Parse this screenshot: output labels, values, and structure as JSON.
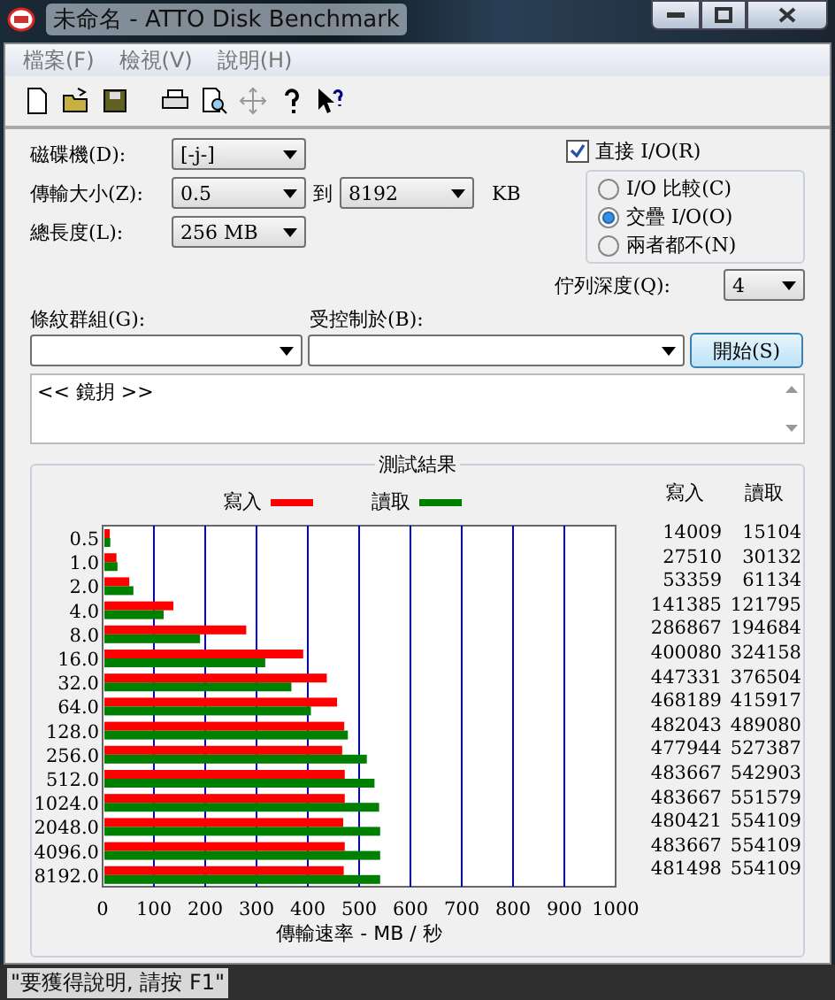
{
  "window": {
    "title": "未命名 - ATTO Disk Benchmark"
  },
  "menu": [
    {
      "label": "檔案(F)"
    },
    {
      "label": "檢視(V)"
    },
    {
      "label": "說明(H)"
    }
  ],
  "toolbar": [
    {
      "kind": "new",
      "disabled": false
    },
    {
      "kind": "open",
      "disabled": false
    },
    {
      "kind": "save",
      "disabled": false
    },
    {
      "kind": "gap"
    },
    {
      "kind": "print",
      "disabled": false
    },
    {
      "kind": "preview",
      "disabled": false
    },
    {
      "kind": "move",
      "disabled": true
    },
    {
      "kind": "help",
      "disabled": false
    },
    {
      "kind": "context-help",
      "disabled": false
    }
  ],
  "settings": {
    "drive": {
      "label": "磁碟機(D):",
      "value": "[-j-]"
    },
    "transfer_size": {
      "label": "傳輸大小(Z):",
      "from": "0.5",
      "joiner": "到",
      "to": "8192",
      "unit": "KB"
    },
    "total_length": {
      "label": "總長度(L):",
      "value": "256 MB"
    },
    "direct_io": {
      "label": "直接 I/O(R)",
      "checked": true
    },
    "io_modes": [
      {
        "label": "I/O 比較(C)",
        "selected": false
      },
      {
        "label": "交疊 I/O(O)",
        "selected": true
      },
      {
        "label": "兩者都不(N)",
        "selected": false
      }
    ],
    "queue_depth": {
      "label": "佇列深度(Q):",
      "value": "4"
    },
    "stripe_group": {
      "label": "條紋群組(G):"
    },
    "controlled_by": {
      "label": "受控制於(B):"
    },
    "start_button": "開始(S)",
    "log": "<< 鏡抈 >>"
  },
  "results": {
    "title": "測試結果",
    "chart_data": {
      "type": "bar",
      "orientation": "horizontal",
      "grid": true,
      "legend": true,
      "xlabel": "傳輸速率 - MB / 秒",
      "categories": [
        "0.5",
        "1.0",
        "2.0",
        "4.0",
        "8.0",
        "16.0",
        "32.0",
        "64.0",
        "128.0",
        "256.0",
        "512.0",
        "1024.0",
        "2048.0",
        "4096.0",
        "8192.0"
      ],
      "xlim": [
        0,
        1000
      ],
      "xticks": [
        0,
        100,
        200,
        300,
        400,
        500,
        600,
        700,
        800,
        900,
        1000
      ],
      "series": [
        {
          "name": "寫入",
          "color": "#ff0000",
          "values": [
            14,
            27,
            52,
            138,
            280,
            391,
            437,
            457,
            471,
            467,
            472,
            472,
            469,
            472,
            470
          ]
        },
        {
          "name": "讀取",
          "color": "#008000",
          "values": [
            15,
            29,
            60,
            119,
            190,
            317,
            368,
            406,
            478,
            515,
            530,
            539,
            541,
            541,
            541
          ]
        }
      ]
    },
    "table": {
      "columns": [
        "寫入",
        "讀取"
      ],
      "rows": [
        [
          "14009",
          "15104"
        ],
        [
          "27510",
          "30132"
        ],
        [
          "53359",
          "61134"
        ],
        [
          "141385",
          "121795"
        ],
        [
          "286867",
          "194684"
        ],
        [
          "400080",
          "324158"
        ],
        [
          "447331",
          "376504"
        ],
        [
          "468189",
          "415917"
        ],
        [
          "482043",
          "489080"
        ],
        [
          "477944",
          "527387"
        ],
        [
          "483667",
          "542903"
        ],
        [
          "483667",
          "551579"
        ],
        [
          "480421",
          "554109"
        ],
        [
          "483667",
          "554109"
        ],
        [
          "481498",
          "554109"
        ]
      ]
    }
  },
  "status_bar": "\"要獲得說明, 請按 F1\""
}
